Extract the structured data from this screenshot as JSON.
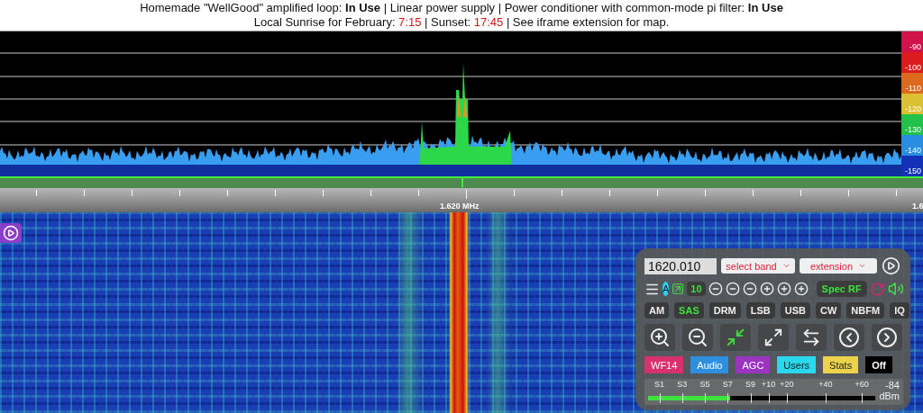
{
  "header": {
    "line_1": "Homemade \"WellGood\" amplified loop: **In Use** | Linear power supply | Power conditioner with common-mode pi filter: **In Use**",
    "line_2": [
      {
        "kind": "text",
        "text": "Local Sunrise for February: "
      },
      {
        "kind": "time",
        "text": "7:15"
      },
      {
        "kind": "text",
        "text": " | Sunset: "
      },
      {
        "kind": "time",
        "text": "17:45"
      },
      {
        "kind": "text",
        "text": " | See iframe extension for map."
      }
    ]
  },
  "db_scale": [
    {
      "label": "-90",
      "color": "#d0144a"
    },
    {
      "label": "-100",
      "color": "#dc1c1c"
    },
    {
      "label": "-110",
      "color": "#dc6a1e"
    },
    {
      "label": "-120",
      "color": "#dcc034"
    },
    {
      "label": "-130",
      "color": "#22c24a"
    },
    {
      "label": "-140",
      "color": "#2a8ee0"
    },
    {
      "label": "-150",
      "color": "#1432b8"
    }
  ],
  "frequency_scale": {
    "center_label": "1.620 MHz",
    "edge_label": "1.6"
  },
  "panel": {
    "frequency": "1620.010",
    "band_select": "select band",
    "extension_select": "extension",
    "user_badge": "A",
    "zoom_level": "10",
    "spec_button": "Spec RF",
    "modes": [
      {
        "label": "AM",
        "selected": false
      },
      {
        "label": "SAS",
        "selected": true
      },
      {
        "label": "DRM",
        "selected": false
      },
      {
        "label": "LSB",
        "selected": false
      },
      {
        "label": "USB",
        "selected": false
      },
      {
        "label": "CW",
        "selected": false
      },
      {
        "label": "NBFM",
        "selected": false
      },
      {
        "label": "IQ",
        "selected": false
      }
    ],
    "tabs": [
      {
        "label": "WF14",
        "color": "#d8326e"
      },
      {
        "label": "Audio",
        "color": "#2e8fe0"
      },
      {
        "label": "AGC",
        "color": "#9b35c0"
      },
      {
        "label": "Users",
        "color": "#2ad8ee"
      },
      {
        "label": "Stats",
        "color": "#ecd34a"
      },
      {
        "label": "Off",
        "color": "#000000"
      }
    ],
    "meter": {
      "labels": [
        "S1",
        "S3",
        "S5",
        "S7",
        "S9",
        "+10",
        "+20",
        "+40",
        "+60"
      ],
      "reading": "-84",
      "unit": "dBm",
      "level": 0.36
    }
  }
}
